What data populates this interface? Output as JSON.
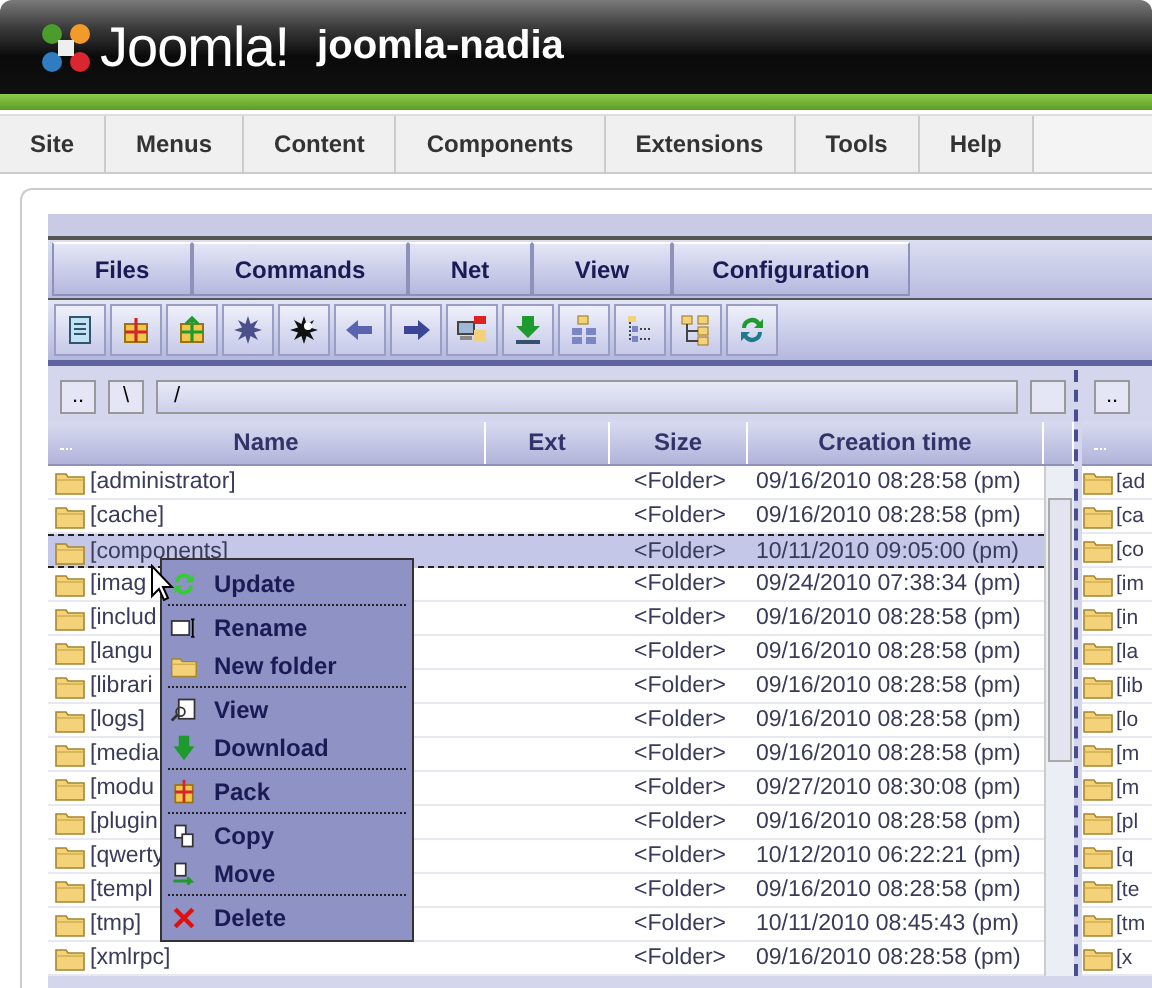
{
  "header": {
    "logo_text": "Joomla!",
    "site_name": "joomla-nadia"
  },
  "main_menu": [
    "Site",
    "Menus",
    "Content",
    "Components",
    "Extensions",
    "Tools",
    "Help"
  ],
  "panel_menu": [
    "Files",
    "Commands",
    "Net",
    "View",
    "Configuration"
  ],
  "left_pane": {
    "nav": [
      "..",
      "\\"
    ],
    "path": "/",
    "columns": [
      "Name",
      "Ext",
      "Size",
      "Creation time"
    ],
    "rows": [
      {
        "name": "[administrator]",
        "size": "<Folder>",
        "created": "09/16/2010 08:28:58 (pm)",
        "selected": false
      },
      {
        "name": "[cache]",
        "size": "<Folder>",
        "created": "09/16/2010 08:28:58 (pm)",
        "selected": false
      },
      {
        "name": "[components]",
        "size": "<Folder>",
        "created": "10/11/2010 09:05:00 (pm)",
        "selected": true
      },
      {
        "name": "[imag",
        "size": "<Folder>",
        "created": "09/24/2010 07:38:34 (pm)",
        "selected": false
      },
      {
        "name": "[includ",
        "size": "<Folder>",
        "created": "09/16/2010 08:28:58 (pm)",
        "selected": false
      },
      {
        "name": "[langu",
        "size": "<Folder>",
        "created": "09/16/2010 08:28:58 (pm)",
        "selected": false
      },
      {
        "name": "[librari",
        "size": "<Folder>",
        "created": "09/16/2010 08:28:58 (pm)",
        "selected": false
      },
      {
        "name": "[logs]",
        "size": "<Folder>",
        "created": "09/16/2010 08:28:58 (pm)",
        "selected": false
      },
      {
        "name": "[media",
        "size": "<Folder>",
        "created": "09/16/2010 08:28:58 (pm)",
        "selected": false
      },
      {
        "name": "[modu",
        "size": "<Folder>",
        "created": "09/27/2010 08:30:08 (pm)",
        "selected": false
      },
      {
        "name": "[plugin",
        "size": "<Folder>",
        "created": "09/16/2010 08:28:58 (pm)",
        "selected": false
      },
      {
        "name": "[qwerty",
        "size": "<Folder>",
        "created": "10/12/2010 06:22:21 (pm)",
        "selected": false
      },
      {
        "name": "[templ",
        "size": "<Folder>",
        "created": "09/16/2010 08:28:58 (pm)",
        "selected": false
      },
      {
        "name": "[tmp]",
        "size": "<Folder>",
        "created": "10/11/2010 08:45:43 (pm)",
        "selected": false
      },
      {
        "name": "[xmlrpc]",
        "size": "<Folder>",
        "created": "09/16/2010 08:28:58 (pm)",
        "selected": false
      }
    ]
  },
  "right_pane": {
    "nav": [
      ".."
    ],
    "rows": [
      "[ad",
      "[ca",
      "[co",
      "[im",
      "[in",
      "[la",
      "[lib",
      "[lo",
      "[m",
      "[m",
      "[pl",
      "[q",
      "[te",
      "[tm",
      "[x"
    ]
  },
  "context_menu": [
    [
      "Update"
    ],
    [
      "Rename",
      "New folder"
    ],
    [
      "View",
      "Download"
    ],
    [
      "Pack"
    ],
    [
      "Copy",
      "Move"
    ],
    [
      "Delete"
    ]
  ]
}
